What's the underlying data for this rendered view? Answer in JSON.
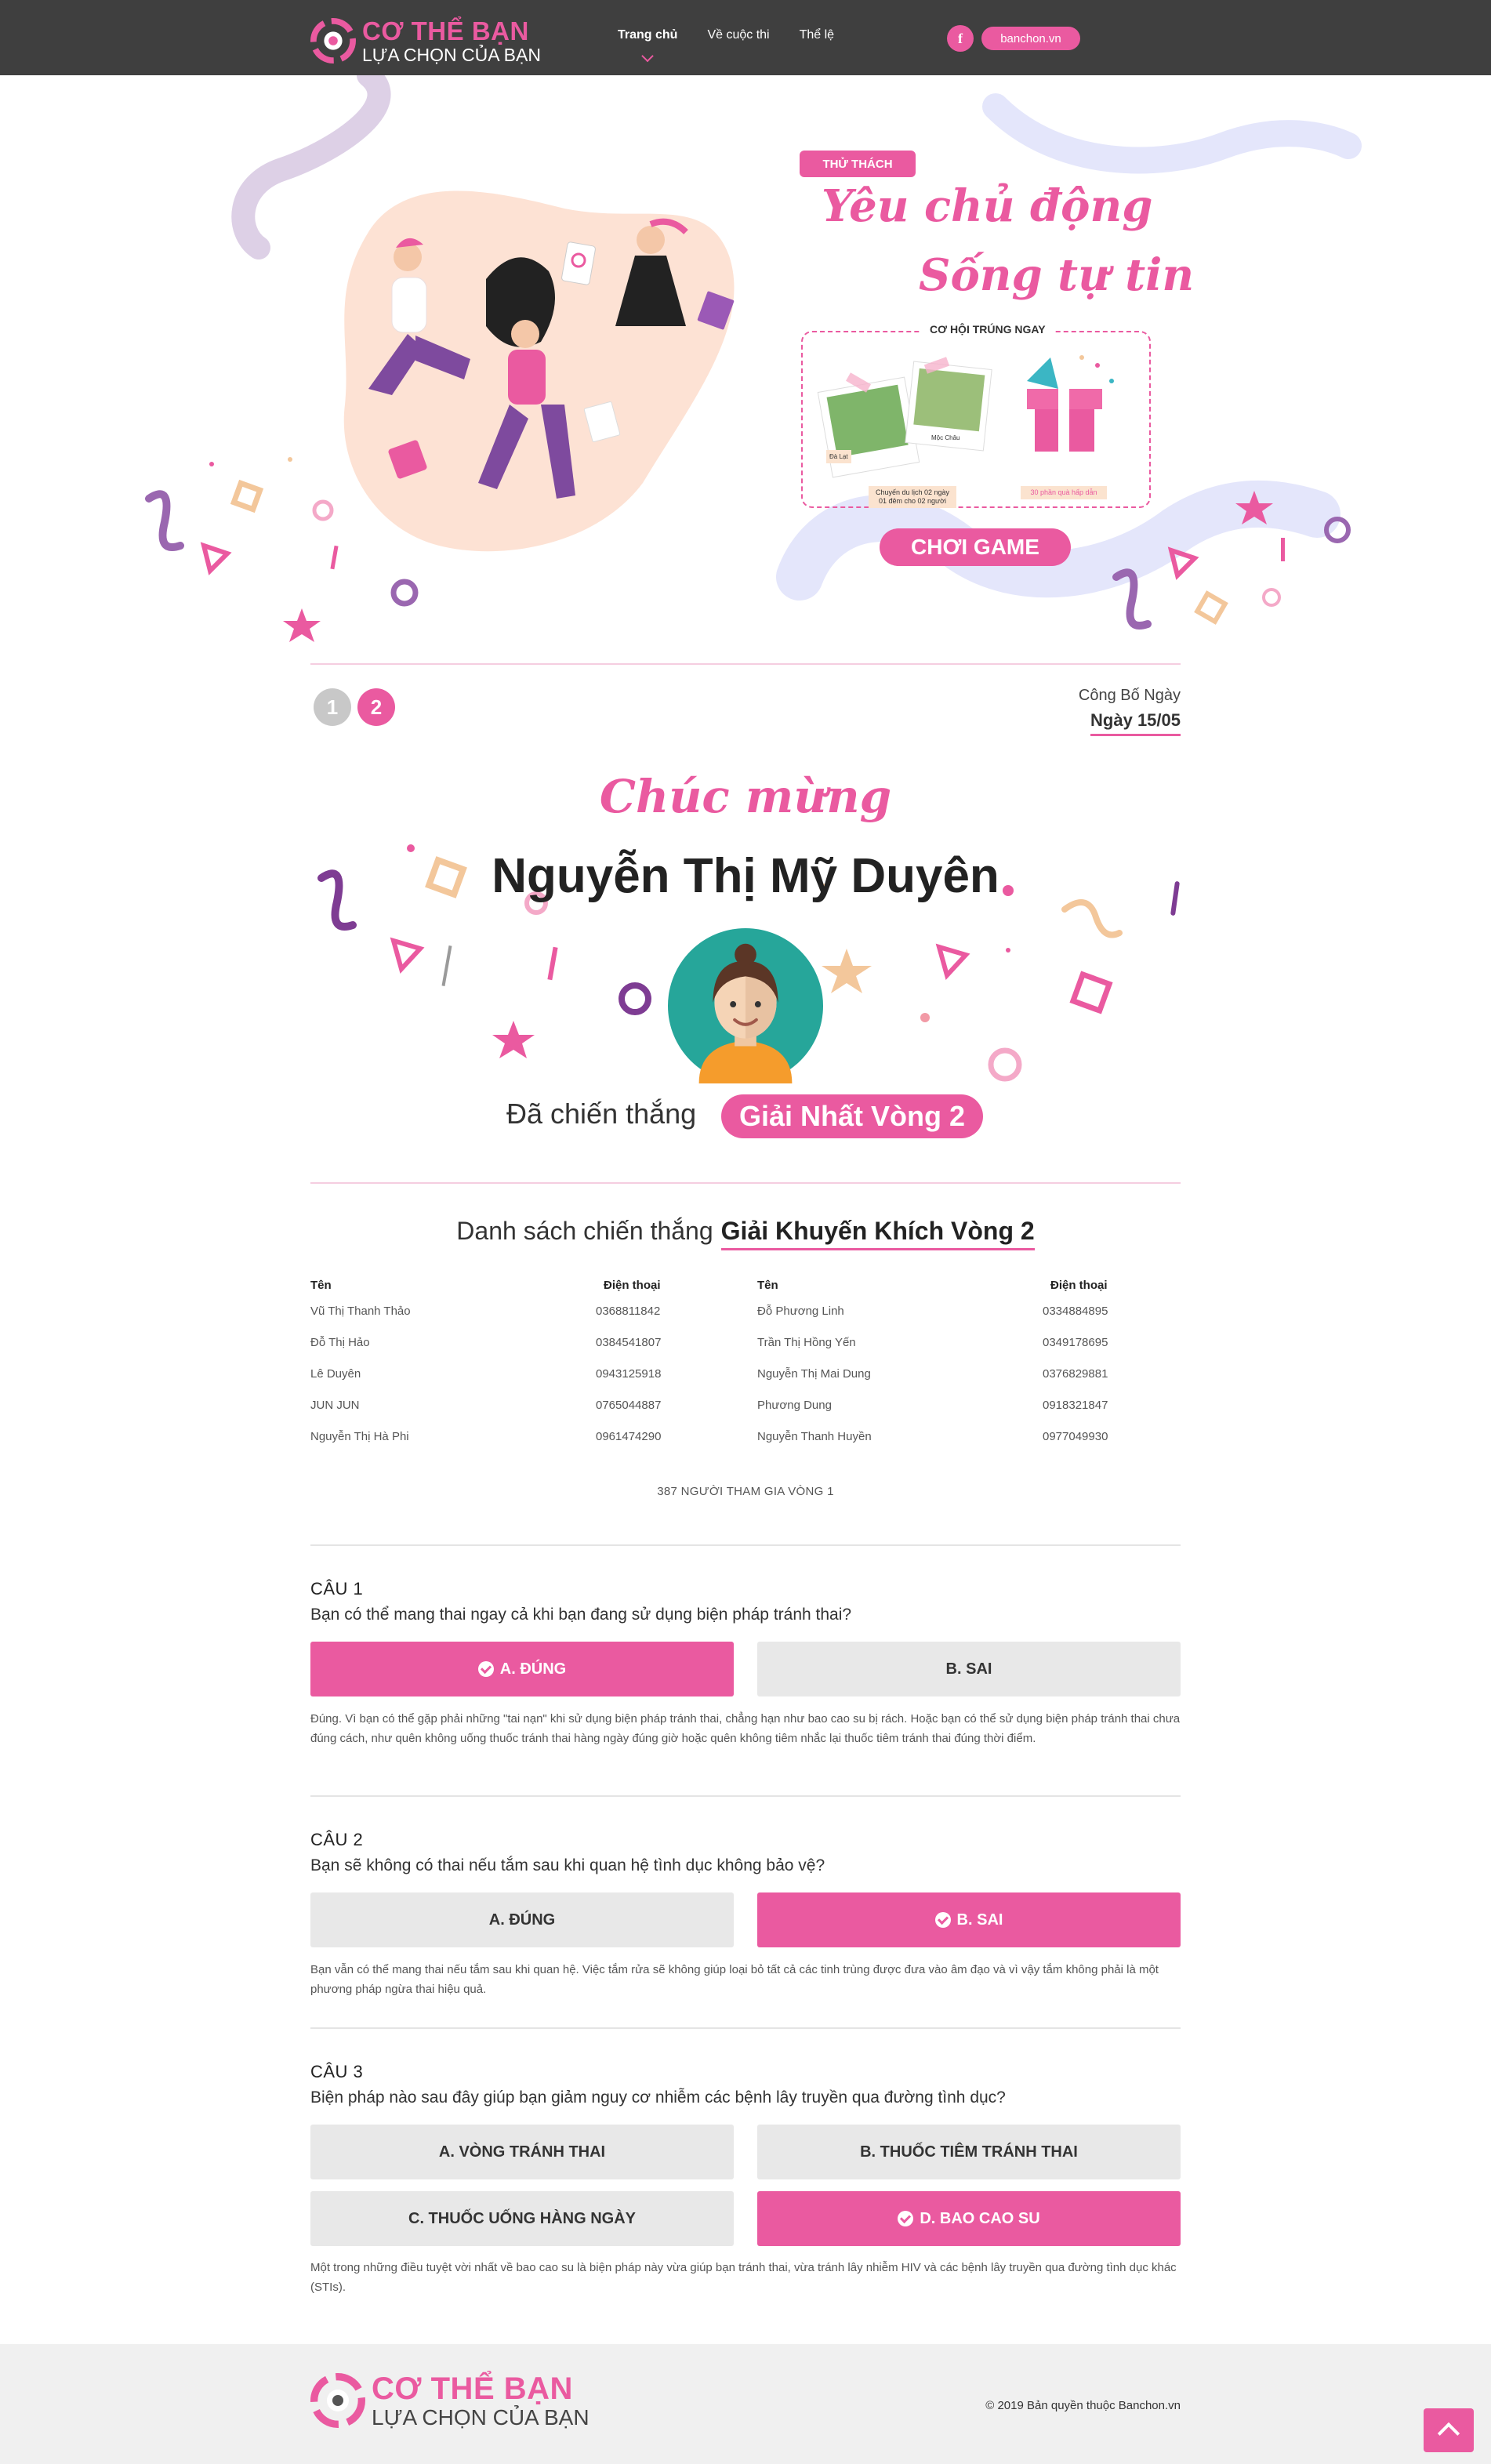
{
  "header": {
    "logo_line1": "CƠ THỂ BẠN",
    "logo_line2": "LỰA CHỌN CỦA BẠN",
    "nav": [
      "Trang chủ",
      "Về cuộc thi",
      "Thể lệ"
    ],
    "facebook_glyph": "f",
    "site_link": "banchon.vn"
  },
  "hero": {
    "tag": "THỬ THÁCH",
    "title_line1": "Yêu chủ động",
    "title_line2": "Sống tự tin",
    "prize_label": "CƠ HỘI TRÚNG NGAY",
    "prize_note_trip": "Chuyến du lịch 02 ngày 01 đêm cho 02 người",
    "prize_note_gift": "30 phần quà hấp dẫn",
    "photo1_caption": "Đà Lạt",
    "photo2_caption": "Mộc Châu",
    "play_button": "CHƠI GAME"
  },
  "round": {
    "items": [
      "1",
      "2"
    ],
    "announce_label": "Công Bố Ngày",
    "announce_date": "Ngày 15/05"
  },
  "winner": {
    "congrats": "Chúc mừng",
    "name": "Nguyễn Thị Mỹ Duyên",
    "won_text": "Đã chiến thắng",
    "prize": "Giải Nhất Vòng 2"
  },
  "winners_list": {
    "heading": "Danh sách chiến thắng",
    "heading_bold": "Giải Khuyến Khích Vòng 2",
    "col_name": "Tên",
    "col_phone": "Điện thoại",
    "left": [
      {
        "name": "Vũ Thị Thanh Thảo",
        "phone": "0368811842"
      },
      {
        "name": "Đỗ Thị Hảo",
        "phone": "0384541807"
      },
      {
        "name": "Lê Duyên",
        "phone": "0943125918"
      },
      {
        "name": "JUN JUN",
        "phone": "0765044887"
      },
      {
        "name": "Nguyễn Thị Hà Phi",
        "phone": "0961474290"
      }
    ],
    "right": [
      {
        "name": "Đỗ Phương Linh",
        "phone": "0334884895"
      },
      {
        "name": "Trần Thị Hồng Yến",
        "phone": "0349178695"
      },
      {
        "name": "Nguyễn Thị Mai Dung",
        "phone": "0376829881"
      },
      {
        "name": "Phương Dung",
        "phone": "0918321847"
      },
      {
        "name": "Nguyễn Thanh Huyền",
        "phone": "0977049930"
      }
    ],
    "participants": "387 NGƯỜI THAM GIA VÒNG 1"
  },
  "questions": [
    {
      "num": "CÂU 1",
      "text": "Bạn có thể mang thai ngay cả khi bạn đang sử dụng biện pháp tránh thai?",
      "answers": [
        "A. ĐÚNG",
        "B. SAI"
      ],
      "selected": 0,
      "explanation": "Đúng. Vì bạn có thể gặp phải những \"tai nạn\" khi sử dụng biện pháp tránh thai, chẳng hạn như bao cao su bị rách. Hoặc bạn có thể sử dụng biện pháp tránh thai chưa đúng cách, như quên không uống thuốc tránh thai hàng ngày đúng giờ hoặc quên không tiêm nhắc lại thuốc tiêm tránh thai đúng thời điểm."
    },
    {
      "num": "CÂU 2",
      "text": "Bạn sẽ không có thai nếu tắm sau khi quan hệ tình dục không bảo vệ?",
      "answers": [
        "A. ĐÚNG",
        "B. SAI"
      ],
      "selected": 1,
      "explanation": "Bạn vẫn có thể mang thai nếu tắm sau khi quan hệ. Việc tắm rửa sẽ không giúp loại bỏ tất cả các tinh trùng được đưa vào âm đạo và vì vậy tắm không phải là một phương pháp ngừa thai hiệu quả."
    },
    {
      "num": "CÂU 3",
      "text": "Biện pháp nào sau đây giúp bạn giảm nguy cơ nhiễm các bệnh lây truyền qua đường tình dục?",
      "answers": [
        "A. VÒNG TRÁNH THAI",
        "B. THUỐC TIÊM TRÁNH THAI",
        "C. THUỐC UỐNG HÀNG NGÀY",
        "D. BAO CAO SU"
      ],
      "selected": 3,
      "explanation": "Một trong những điều tuyệt vời nhất về bao cao su là biện pháp này vừa giúp bạn tránh thai, vừa tránh lây nhiễm HIV và các bệnh lây truyền qua đường tình dục khác (STIs)."
    }
  ],
  "footer": {
    "logo_line1": "CƠ THỂ BẠN",
    "logo_line2": "LỰA CHỌN CỦA BẠN",
    "copyright": "© 2019 Bản quyền thuộc Banchon.vn"
  },
  "colors": {
    "accent": "#ea5aa0",
    "header_bg": "#3f3f3f",
    "button_grey": "#e8e8e8",
    "footer_bg": "#f0f0f0"
  }
}
